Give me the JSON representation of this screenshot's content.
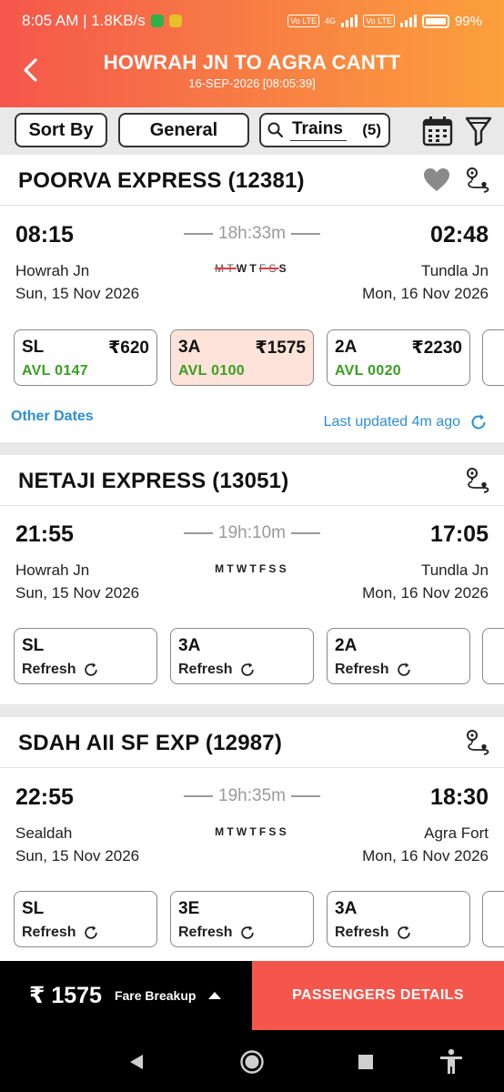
{
  "status_bar": {
    "time_speed": "8:05 AM | 1.8KB/s",
    "volte1": "Vo LTE",
    "net": "4G",
    "volte2": "Vo LTE",
    "battery": "99%"
  },
  "header": {
    "title": "HOWRAH JN TO AGRA CANTT",
    "subtitle": "16-SEP-2026 [08:05:39]"
  },
  "filters": {
    "sort_label": "Sort By",
    "quota_label": "General",
    "trains_label": "Trains",
    "trains_count": "(5)"
  },
  "trains": [
    {
      "name": "POORVA EXPRESS (12381)",
      "dep_time": "08:15",
      "arr_time": "02:48",
      "duration": "18h:33m",
      "days": [
        {
          "d": "M",
          "off": true
        },
        {
          "d": "T",
          "off": true
        },
        {
          "d": "W",
          "off": false
        },
        {
          "d": "T",
          "off": false
        },
        {
          "d": "F",
          "off": true
        },
        {
          "d": "S",
          "off": true
        },
        {
          "d": "S",
          "off": false
        }
      ],
      "from": "Howrah Jn",
      "to": "Tundla Jn",
      "dep_date": "Sun, 15 Nov 2026",
      "arr_date": "Mon, 16 Nov 2026",
      "classes": [
        {
          "cls": "SL",
          "fare": "₹620",
          "avl": "AVL 0147"
        },
        {
          "cls": "3A",
          "fare": "₹1575",
          "avl": "AVL 0100"
        },
        {
          "cls": "2A",
          "fare": "₹2230",
          "avl": "AVL 0020"
        }
      ],
      "other_dates": "Other Dates",
      "last_updated": "Last updated 4m ago"
    },
    {
      "name": "NETAJI EXPRESS (13051)",
      "dep_time": "21:55",
      "arr_time": "17:05",
      "duration": "19h:10m",
      "days_text": "MTWTFSS",
      "from": "Howrah Jn",
      "to": "Tundla Jn",
      "dep_date": "Sun, 15 Nov 2026",
      "arr_date": "Mon, 16 Nov 2026",
      "classes": [
        {
          "cls": "SL"
        },
        {
          "cls": "3A"
        },
        {
          "cls": "2A"
        }
      ],
      "refresh_label": "Refresh"
    },
    {
      "name": "SDAH AII SF EXP (12987)",
      "dep_time": "22:55",
      "arr_time": "18:30",
      "duration": "19h:35m",
      "days_text": "MTWTFSS",
      "from": "Sealdah",
      "to": "Agra Fort",
      "dep_date": "Sun, 15 Nov 2026",
      "arr_date": "Mon, 16 Nov 2026",
      "classes": [
        {
          "cls": "SL"
        },
        {
          "cls": "3E"
        },
        {
          "cls": "3A"
        }
      ],
      "refresh_label": "Refresh"
    }
  ],
  "bottom": {
    "fare": "₹ 1575",
    "fare_breakup": "Fare Breakup",
    "passengers_btn": "PASSENGERS DETAILS"
  },
  "colors": {
    "accent": "#f5564b",
    "header_end": "#fba03b",
    "available": "#3a9e22",
    "link": "#2d8fd1",
    "selected_class_bg": "#fde3d9",
    "heart": "#8a8a8a"
  },
  "icons": [
    "back-arrow-icon",
    "search-icon",
    "calendar-icon",
    "filter-icon",
    "heart-icon",
    "route-icon",
    "refresh-icon"
  ]
}
